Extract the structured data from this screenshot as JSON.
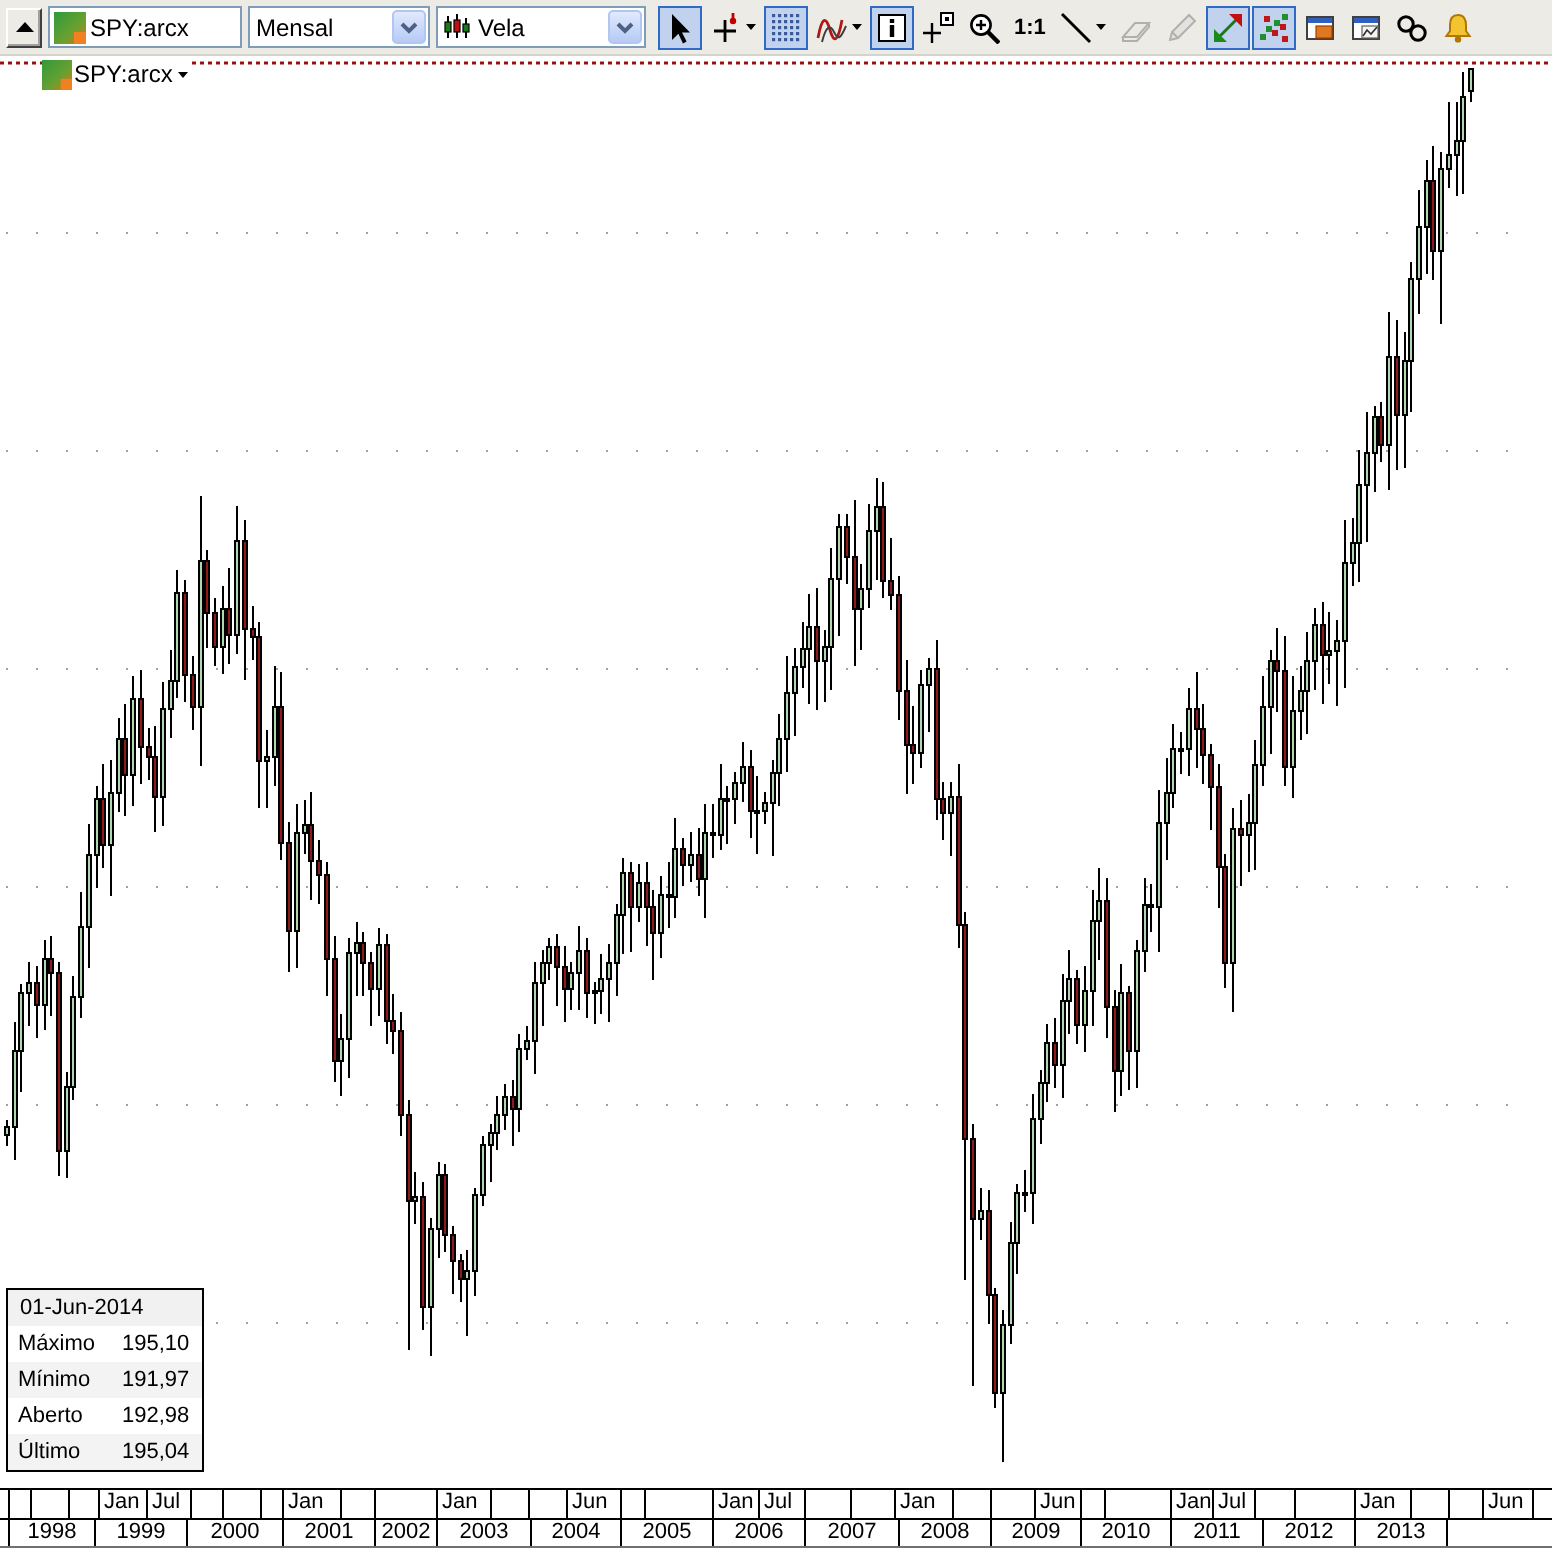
{
  "toolbar": {
    "symbol_field": {
      "value": "SPY:arcx"
    },
    "period_select": {
      "value": "Mensal"
    },
    "chart_type_select": {
      "value": "Vela"
    },
    "tools": [
      {
        "kind": "icon",
        "selected": true,
        "disabled": false,
        "menu": false
      },
      {
        "kind": "icon",
        "selected": false,
        "disabled": false,
        "menu": true
      },
      {
        "kind": "icon",
        "selected": true,
        "disabled": false,
        "menu": false
      },
      {
        "kind": "icon",
        "selected": false,
        "disabled": false,
        "menu": true
      },
      {
        "kind": "icon",
        "selected": true,
        "disabled": false,
        "menu": false
      },
      {
        "kind": "icon",
        "selected": false,
        "disabled": false,
        "menu": false
      },
      {
        "kind": "icon",
        "selected": false,
        "disabled": false,
        "menu": false
      },
      {
        "kind": "text",
        "label": "1:1",
        "selected": false,
        "disabled": false,
        "menu": false
      },
      {
        "kind": "icon",
        "selected": false,
        "disabled": false,
        "menu": true
      },
      {
        "kind": "icon",
        "selected": false,
        "disabled": true,
        "menu": false
      },
      {
        "kind": "icon",
        "selected": false,
        "disabled": true,
        "menu": false
      },
      {
        "kind": "icon",
        "selected": true,
        "disabled": false,
        "menu": false
      },
      {
        "kind": "icon",
        "selected": true,
        "disabled": false,
        "menu": false
      },
      {
        "kind": "icon",
        "selected": false,
        "disabled": false,
        "menu": false
      },
      {
        "kind": "icon",
        "selected": false,
        "disabled": false,
        "menu": false
      },
      {
        "kind": "icon",
        "selected": false,
        "disabled": false,
        "menu": false
      },
      {
        "kind": "icon",
        "selected": false,
        "disabled": false,
        "menu": false
      }
    ]
  },
  "chart": {
    "symbol_label": "SPY:arcx",
    "info_box": {
      "date": "01-Jun-2014",
      "rows": [
        {
          "label": "Máximo",
          "value": "195,10"
        },
        {
          "label": "Mínimo",
          "value": "191,97"
        },
        {
          "label": "Aberto",
          "value": "192,98"
        },
        {
          "label": "Último",
          "value": "195,04"
        }
      ]
    }
  },
  "x_axis": {
    "upper_labels": [
      "Jan",
      "Jul",
      "Jan",
      "Jan",
      "Jun",
      "Jan",
      "Jul",
      "Jan",
      "Jun",
      "Jan",
      "Jul",
      "Jan",
      "Jun"
    ],
    "years": [
      "1998",
      "1999",
      "2000",
      "2001",
      "2002",
      "2003",
      "2004",
      "2005",
      "2006",
      "2007",
      "2008",
      "2009",
      "2010",
      "2011",
      "2012",
      "2013"
    ]
  }
}
